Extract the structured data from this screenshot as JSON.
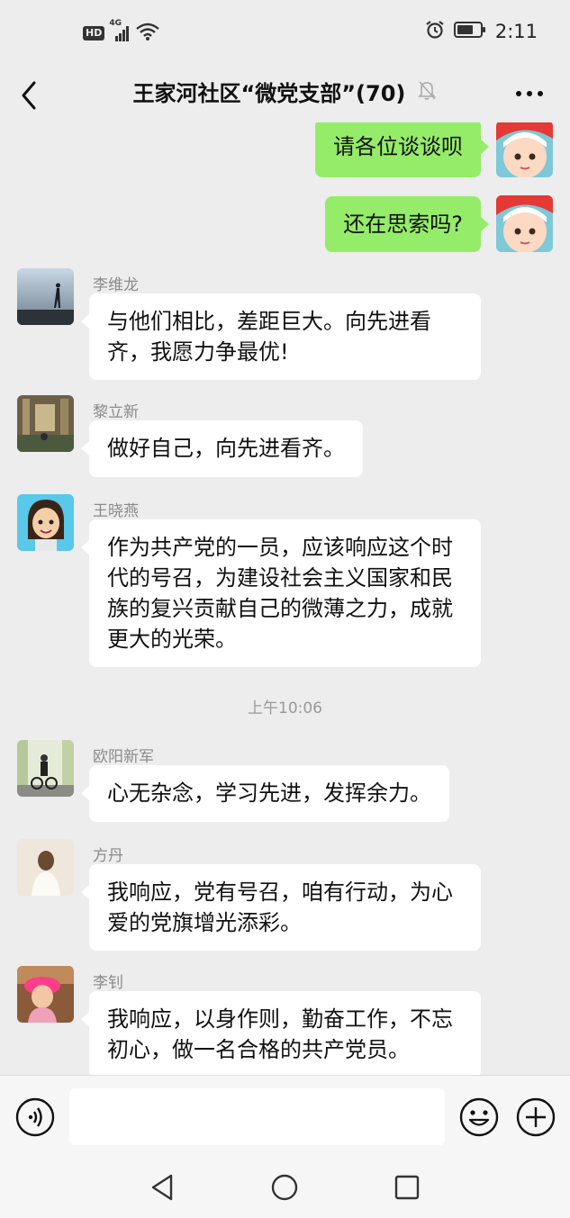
{
  "status_bar": {
    "hd": "HD",
    "network": "4G",
    "time": "2:11"
  },
  "header": {
    "title": "王家河社区“微党支部”(70)"
  },
  "messages": [
    {
      "type": "outgoing",
      "text": "请各位谈谈呗"
    },
    {
      "type": "outgoing",
      "text": "还在思索吗?"
    },
    {
      "type": "incoming",
      "sender": "李维龙",
      "text": "与他们相比，差距巨大。向先进看齐，我愿力争最优!"
    },
    {
      "type": "incoming",
      "sender": "黎立新",
      "text": "做好自己，向先进看齐。"
    },
    {
      "type": "incoming",
      "sender": "王晓燕",
      "text": "作为共产党的一员，应该响应这个时代的号召，为建设社会主义国家和民族的复兴贡献自己的微薄之力，成就更大的光荣。"
    },
    {
      "type": "time",
      "text": "上午10:06"
    },
    {
      "type": "incoming",
      "sender": "欧阳新军",
      "text": "心无杂念，学习先进，发挥余力。"
    },
    {
      "type": "incoming",
      "sender": "方丹",
      "text": "我响应，党有号召，咱有行动，为心爱的党旗增光添彩。"
    },
    {
      "type": "incoming",
      "sender": "李钊",
      "text": "我响应，以身作则，勤奋工作，不忘初心，做一名合格的共产党员。"
    }
  ],
  "input": {
    "placeholder": ""
  },
  "colors": {
    "background": "#ededed",
    "outgoing_bubble": "#95ec69",
    "incoming_bubble": "#ffffff"
  },
  "icons": [
    "back-arrow-icon",
    "bell-muted-icon",
    "more-dots-icon",
    "voice-icon",
    "emoji-icon",
    "plus-icon",
    "nav-back-icon",
    "nav-home-icon",
    "nav-recent-icon",
    "alarm-icon",
    "battery-icon",
    "wifi-icon",
    "signal-icon"
  ]
}
